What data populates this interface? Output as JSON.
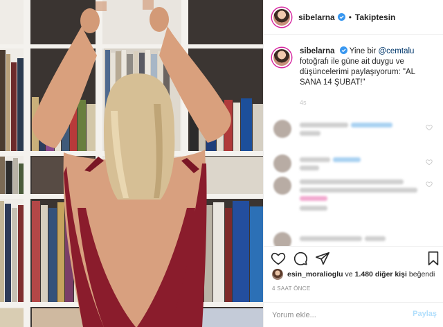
{
  "header": {
    "username": "sibelarna",
    "separator": "•",
    "follow_status": "Takiptesin",
    "verified_icon": "verified-badge-icon"
  },
  "caption": {
    "username": "sibelarna",
    "text_before": "Yine bir",
    "mention": "@cemtalu",
    "text_after": "fotoğrafı ile güne ait duygu ve düşüncelerimi paylaşıyorum: \"AL SANA 14 ŞUBAT!\"",
    "time": "4s"
  },
  "actions": {
    "like_icon": "heart-icon",
    "comment_icon": "comment-icon",
    "share_icon": "paper-plane-icon",
    "save_icon": "bookmark-icon"
  },
  "likes": {
    "first_user": "esin_moralioglu",
    "connector": "ve",
    "count_text": "1.480 diğer kişi",
    "suffix": "beğendi"
  },
  "timestamp": "4 SAAT ÖNCE",
  "add_comment": {
    "placeholder": "Yorum ekle...",
    "post_label": "Paylaş"
  },
  "colors": {
    "text": "#262626",
    "mention": "#00376b",
    "muted": "#8e8e8e",
    "post_disabled": "#b2dffc",
    "verified": "#3897f0",
    "dress": "#8a1c2c"
  }
}
